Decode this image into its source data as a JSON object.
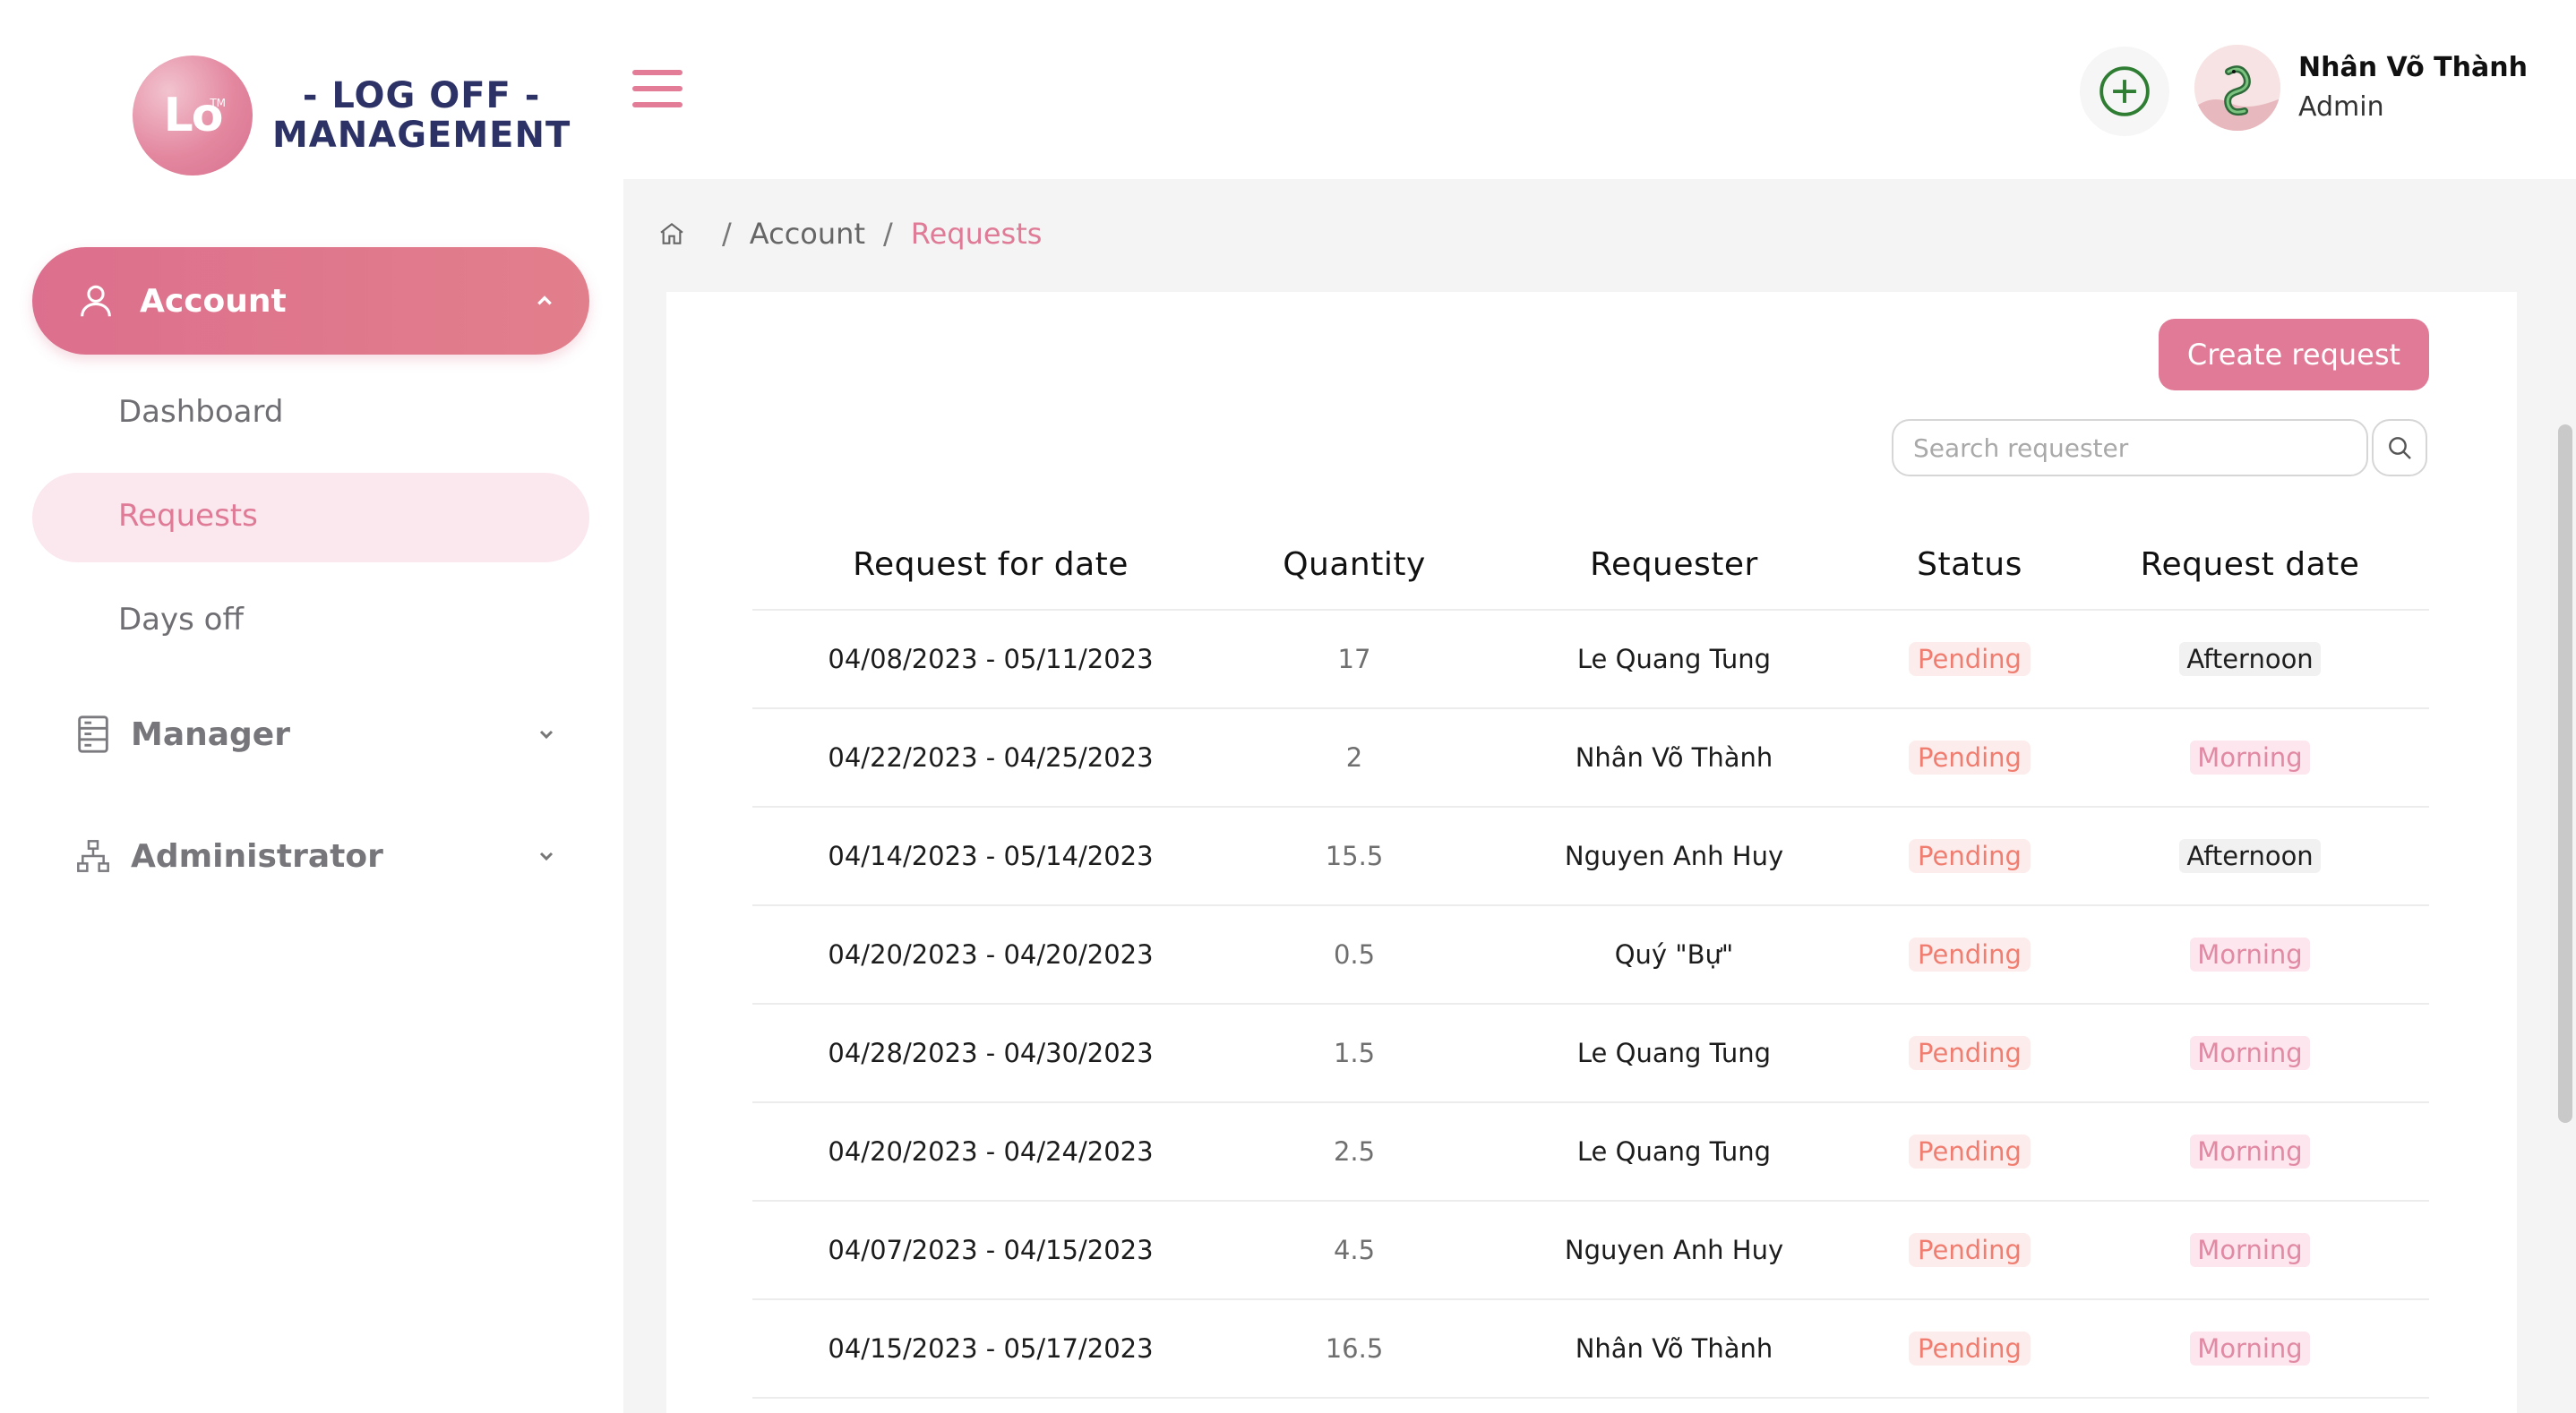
{
  "logo": {
    "mark": "Lo",
    "tm": "TM",
    "line1": "- LOG OFF -",
    "line2": "MANAGEMENT"
  },
  "sidebar": {
    "account": {
      "label": "Account",
      "icon": "user-icon"
    },
    "account_items": [
      "Dashboard",
      "Requests",
      "Days off"
    ],
    "active_item": "Requests",
    "manager": {
      "label": "Manager",
      "icon": "server-icon"
    },
    "administrator": {
      "label": "Administrator",
      "icon": "org-chart-icon"
    }
  },
  "header": {
    "menu_icon": "hamburger-icon",
    "add_icon": "plus-circle-icon",
    "user": {
      "name": "Nhân Võ Thành",
      "role": "Admin"
    }
  },
  "breadcrumb": {
    "home_icon": "home-icon",
    "items": [
      "Account",
      "Requests"
    ]
  },
  "toolbar": {
    "create_label": "Create request",
    "search_placeholder": "Search requester",
    "search_icon": "search-icon"
  },
  "table": {
    "headers": [
      "Request for date",
      "Quantity",
      "Requester",
      "Status",
      "Request date"
    ],
    "rows": [
      {
        "range": "04/08/2023 - 05/11/2023",
        "qty": "17",
        "requester": "Le Quang Tung",
        "status": "Pending",
        "period": "Afternoon"
      },
      {
        "range": "04/22/2023 - 04/25/2023",
        "qty": "2",
        "requester": "Nhân Võ Thành",
        "status": "Pending",
        "period": "Morning"
      },
      {
        "range": "04/14/2023 - 05/14/2023",
        "qty": "15.5",
        "requester": "Nguyen Anh Huy",
        "status": "Pending",
        "period": "Afternoon"
      },
      {
        "range": "04/20/2023 - 04/20/2023",
        "qty": "0.5",
        "requester": "Quý \"Bự\"",
        "status": "Pending",
        "period": "Morning"
      },
      {
        "range": "04/28/2023 - 04/30/2023",
        "qty": "1.5",
        "requester": "Le Quang Tung",
        "status": "Pending",
        "period": "Morning"
      },
      {
        "range": "04/20/2023 - 04/24/2023",
        "qty": "2.5",
        "requester": "Le Quang Tung",
        "status": "Pending",
        "period": "Morning"
      },
      {
        "range": "04/07/2023 - 04/15/2023",
        "qty": "4.5",
        "requester": "Nguyen Anh Huy",
        "status": "Pending",
        "period": "Morning"
      },
      {
        "range": "04/15/2023 - 05/17/2023",
        "qty": "16.5",
        "requester": "Nhân Võ Thành",
        "status": "Pending",
        "period": "Morning"
      }
    ]
  },
  "colors": {
    "accent": "#e07a96",
    "accent_light": "#fbe7ee",
    "status_pending": "#ef7e71",
    "brand_navy": "#2c3166"
  }
}
